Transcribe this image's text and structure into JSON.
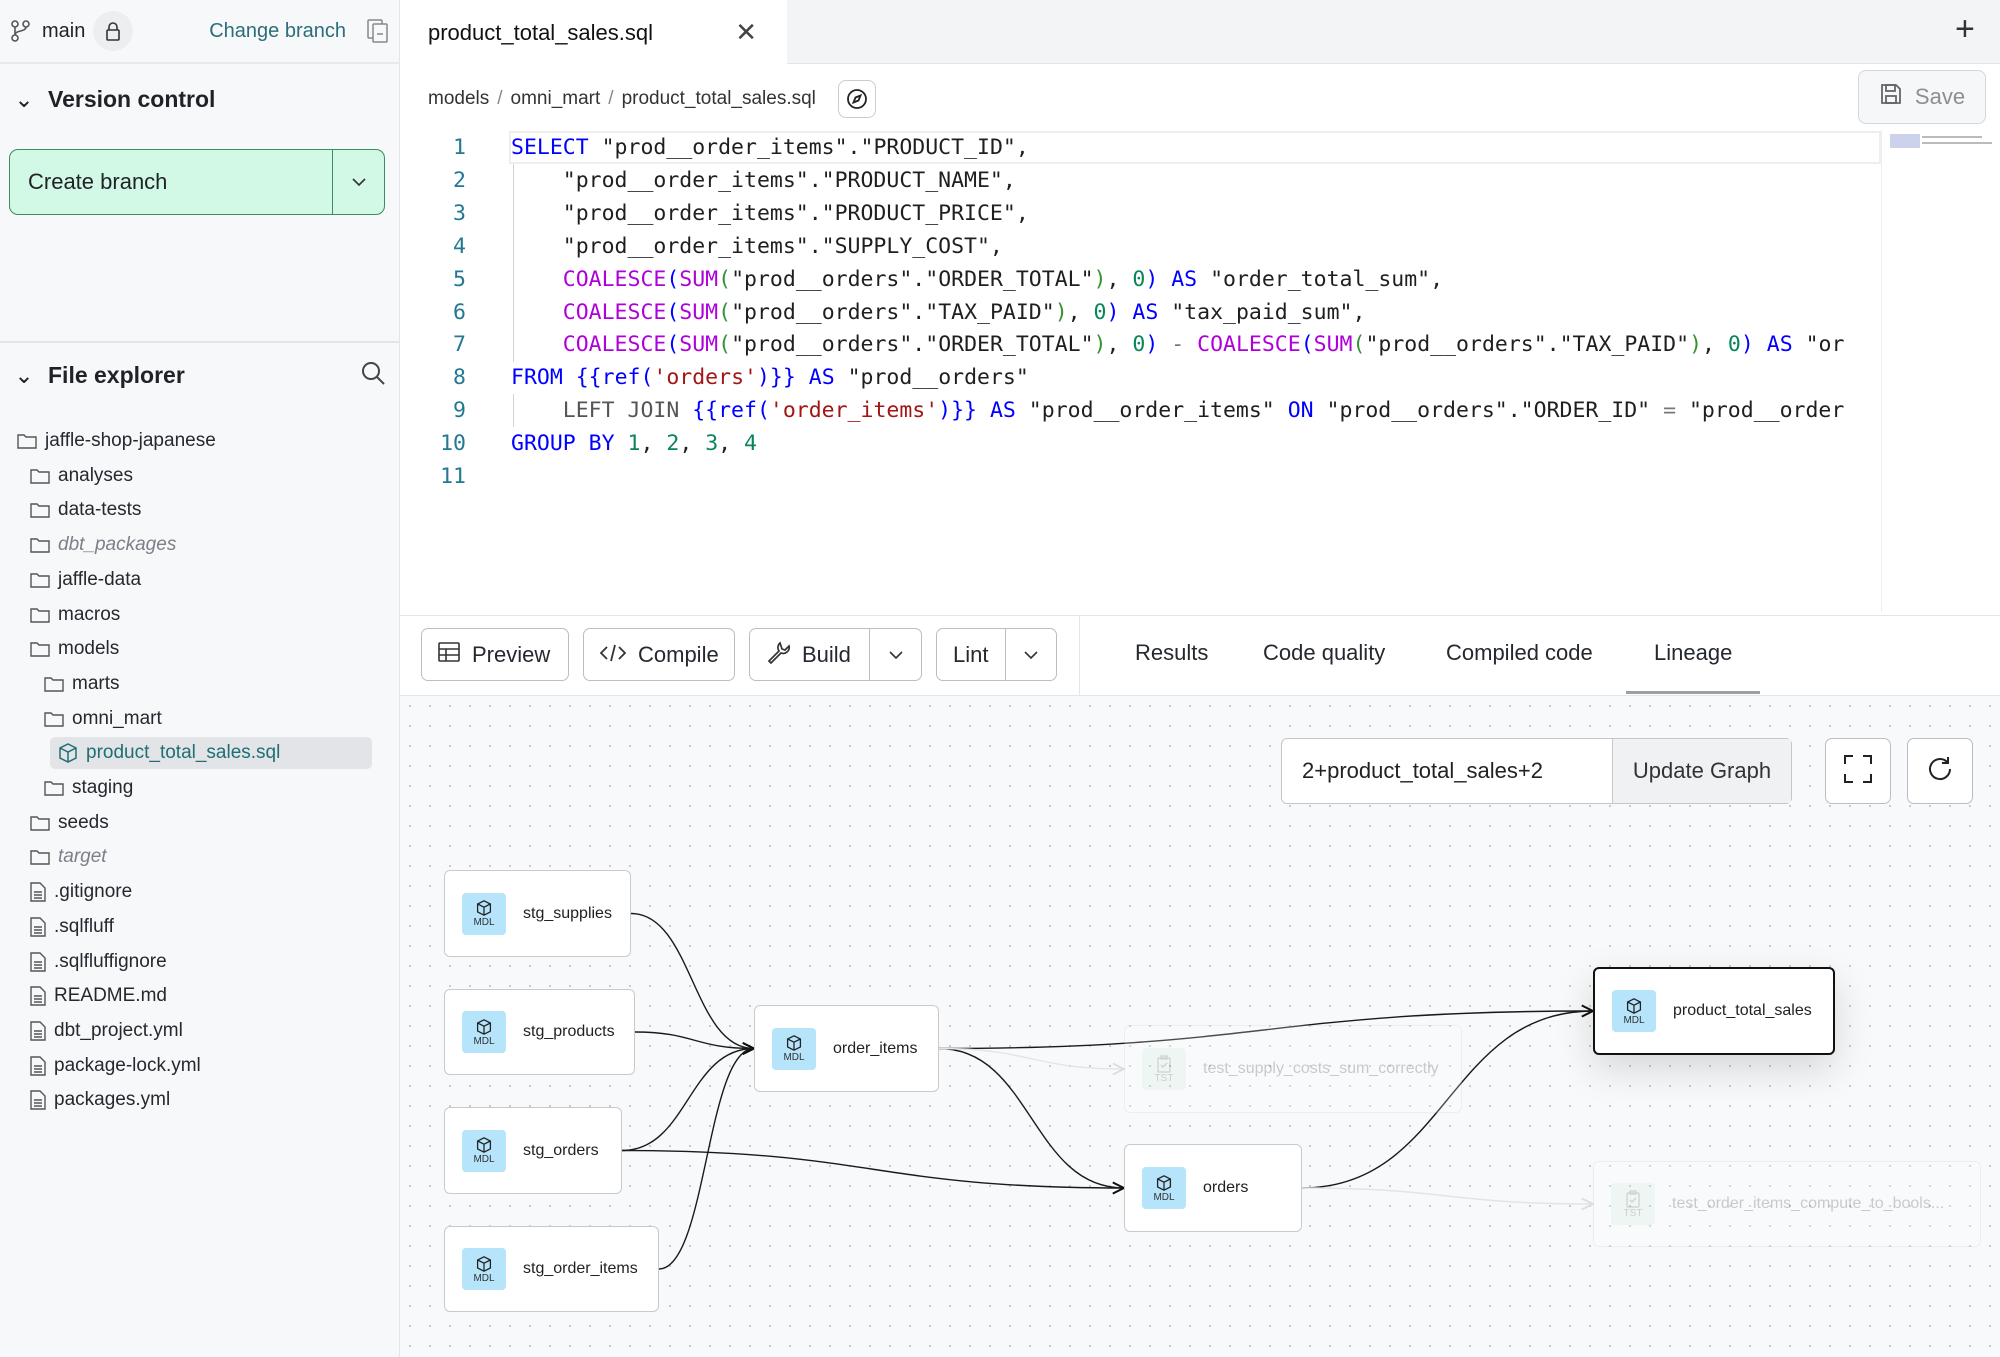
{
  "sidebar": {
    "branch": "main",
    "change_branch": "Change branch",
    "version_control": "Version control",
    "create_branch": "Create branch",
    "file_explorer": "File explorer",
    "tree": [
      {
        "label": "jaffle-shop-japanese",
        "type": "folder",
        "level": 0
      },
      {
        "label": "analyses",
        "type": "folder",
        "level": 1
      },
      {
        "label": "data-tests",
        "type": "folder",
        "level": 1
      },
      {
        "label": "dbt_packages",
        "type": "folder",
        "level": 1,
        "muted": true
      },
      {
        "label": "jaffle-data",
        "type": "folder",
        "level": 1
      },
      {
        "label": "macros",
        "type": "folder",
        "level": 1
      },
      {
        "label": "models",
        "type": "folder",
        "level": 1
      },
      {
        "label": "marts",
        "type": "folder",
        "level": 2
      },
      {
        "label": "omni_mart",
        "type": "folder",
        "level": 2
      },
      {
        "label": "product_total_sales.sql",
        "type": "model",
        "level": 3,
        "selected": true
      },
      {
        "label": "staging",
        "type": "folder",
        "level": 2
      },
      {
        "label": "seeds",
        "type": "folder",
        "level": 1
      },
      {
        "label": "target",
        "type": "folder",
        "level": 1,
        "muted": true
      },
      {
        "label": ".gitignore",
        "type": "file",
        "level": 1
      },
      {
        "label": ".sqlfluff",
        "type": "file",
        "level": 1
      },
      {
        "label": ".sqlfluffignore",
        "type": "file",
        "level": 1
      },
      {
        "label": "README.md",
        "type": "file",
        "level": 1
      },
      {
        "label": "dbt_project.yml",
        "type": "file",
        "level": 1
      },
      {
        "label": "package-lock.yml",
        "type": "file",
        "level": 1
      },
      {
        "label": "packages.yml",
        "type": "file",
        "level": 1
      }
    ]
  },
  "editor": {
    "tab": "product_total_sales.sql",
    "breadcrumb": [
      "models",
      "omni_mart",
      "product_total_sales.sql"
    ],
    "save": "Save",
    "lines": [
      [
        [
          "k",
          "SELECT"
        ],
        [
          "t",
          " \"prod__order_items\".\"PRODUCT_ID\","
        ]
      ],
      [
        [
          "t",
          "    \"prod__order_items\".\"PRODUCT_NAME\","
        ]
      ],
      [
        [
          "t",
          "    \"prod__order_items\".\"PRODUCT_PRICE\","
        ]
      ],
      [
        [
          "t",
          "    \"prod__order_items\".\"SUPPLY_COST\","
        ]
      ],
      [
        [
          "t",
          "    "
        ],
        [
          "f",
          "COALESCE"
        ],
        [
          "k",
          "("
        ],
        [
          "f",
          "SUM"
        ],
        [
          "b2",
          "("
        ],
        [
          "t",
          "\"prod__orders\".\"ORDER_TOTAL\""
        ],
        [
          "b2",
          ")"
        ],
        [
          "t",
          ", "
        ],
        [
          "n",
          "0"
        ],
        [
          "k",
          ")"
        ],
        [
          "t",
          " "
        ],
        [
          "k",
          "AS"
        ],
        [
          "t",
          " \"order_total_sum\","
        ]
      ],
      [
        [
          "t",
          "    "
        ],
        [
          "f",
          "COALESCE"
        ],
        [
          "k",
          "("
        ],
        [
          "f",
          "SUM"
        ],
        [
          "b2",
          "("
        ],
        [
          "t",
          "\"prod__orders\".\"TAX_PAID\""
        ],
        [
          "b2",
          ")"
        ],
        [
          "t",
          ", "
        ],
        [
          "n",
          "0"
        ],
        [
          "k",
          ")"
        ],
        [
          "t",
          " "
        ],
        [
          "k",
          "AS"
        ],
        [
          "t",
          " \"tax_paid_sum\","
        ]
      ],
      [
        [
          "t",
          "    "
        ],
        [
          "f",
          "COALESCE"
        ],
        [
          "k",
          "("
        ],
        [
          "f",
          "SUM"
        ],
        [
          "b2",
          "("
        ],
        [
          "t",
          "\"prod__orders\".\"ORDER_TOTAL\""
        ],
        [
          "b2",
          ")"
        ],
        [
          "t",
          ", "
        ],
        [
          "n",
          "0"
        ],
        [
          "k",
          ")"
        ],
        [
          "t",
          " "
        ],
        [
          "o",
          "-"
        ],
        [
          "t",
          " "
        ],
        [
          "f",
          "COALESCE"
        ],
        [
          "k",
          "("
        ],
        [
          "f",
          "SUM"
        ],
        [
          "b2",
          "("
        ],
        [
          "t",
          "\"prod__orders\".\"TAX_PAID\""
        ],
        [
          "b2",
          ")"
        ],
        [
          "t",
          ", "
        ],
        [
          "n",
          "0"
        ],
        [
          "k",
          ")"
        ],
        [
          "t",
          " "
        ],
        [
          "k",
          "AS"
        ],
        [
          "t",
          " \"or"
        ]
      ],
      [
        [
          "k",
          "FROM"
        ],
        [
          "t",
          " "
        ],
        [
          "k",
          "{{ref("
        ],
        [
          "s",
          "'orders'"
        ],
        [
          "k",
          ")}}"
        ],
        [
          "t",
          " "
        ],
        [
          "k",
          "AS"
        ],
        [
          "t",
          " \"prod__orders\""
        ]
      ],
      [
        [
          "g",
          "    LEFT JOIN "
        ],
        [
          "k",
          "{{ref("
        ],
        [
          "s",
          "'order_items'"
        ],
        [
          "k",
          ")}}"
        ],
        [
          "t",
          " "
        ],
        [
          "k",
          "AS"
        ],
        [
          "t",
          " \"prod__order_items\" "
        ],
        [
          "k",
          "ON"
        ],
        [
          "t",
          " \"prod__orders\".\"ORDER_ID\" "
        ],
        [
          "o",
          "="
        ],
        [
          "t",
          " \"prod__order"
        ]
      ],
      [
        [
          "k",
          "GROUP BY"
        ],
        [
          "t",
          " "
        ],
        [
          "n",
          "1"
        ],
        [
          "t",
          ", "
        ],
        [
          "n",
          "2"
        ],
        [
          "t",
          ", "
        ],
        [
          "n",
          "3"
        ],
        [
          "t",
          ", "
        ],
        [
          "n",
          "4"
        ]
      ],
      []
    ]
  },
  "toolbar": {
    "preview": "Preview",
    "compile": "Compile",
    "build": "Build",
    "lint": "Lint"
  },
  "result_tabs": [
    "Results",
    "Code quality",
    "Compiled code",
    "Lineage"
  ],
  "active_tab": "Lineage",
  "lineage": {
    "selector": "2+product_total_sales+2",
    "update": "Update Graph",
    "nodes": [
      {
        "id": "stg_supplies",
        "label": "stg_supplies",
        "badge": "MDL"
      },
      {
        "id": "stg_products",
        "label": "stg_products",
        "badge": "MDL"
      },
      {
        "id": "stg_orders",
        "label": "stg_orders",
        "badge": "MDL"
      },
      {
        "id": "stg_order_items",
        "label": "stg_order_items",
        "badge": "MDL"
      },
      {
        "id": "order_items",
        "label": "order_items",
        "badge": "MDL"
      },
      {
        "id": "orders",
        "label": "orders",
        "badge": "MDL"
      },
      {
        "id": "product_total_sales",
        "label": "product_total_sales",
        "badge": "MDL",
        "selected": true
      },
      {
        "id": "test_supply",
        "label": "test_supply_costs_sum_correctly",
        "badge": "TST",
        "faded": true
      },
      {
        "id": "test_oi",
        "label": "test_order_items_compute_to_bools...",
        "badge": "TST",
        "faded": true
      }
    ],
    "edges": [
      [
        "stg_supplies",
        "order_items"
      ],
      [
        "stg_products",
        "order_items"
      ],
      [
        "stg_orders",
        "order_items"
      ],
      [
        "stg_order_items",
        "order_items"
      ],
      [
        "stg_orders",
        "orders"
      ],
      [
        "order_items",
        "orders"
      ],
      [
        "order_items",
        "product_total_sales"
      ],
      [
        "orders",
        "product_total_sales"
      ],
      [
        "order_items",
        "test_supply",
        true
      ],
      [
        "orders",
        "test_oi",
        true
      ]
    ],
    "colors": {
      "model_badge": "#b5e4fb",
      "test_badge": "#c8f0d8",
      "accent": "#d2f8e6"
    }
  }
}
